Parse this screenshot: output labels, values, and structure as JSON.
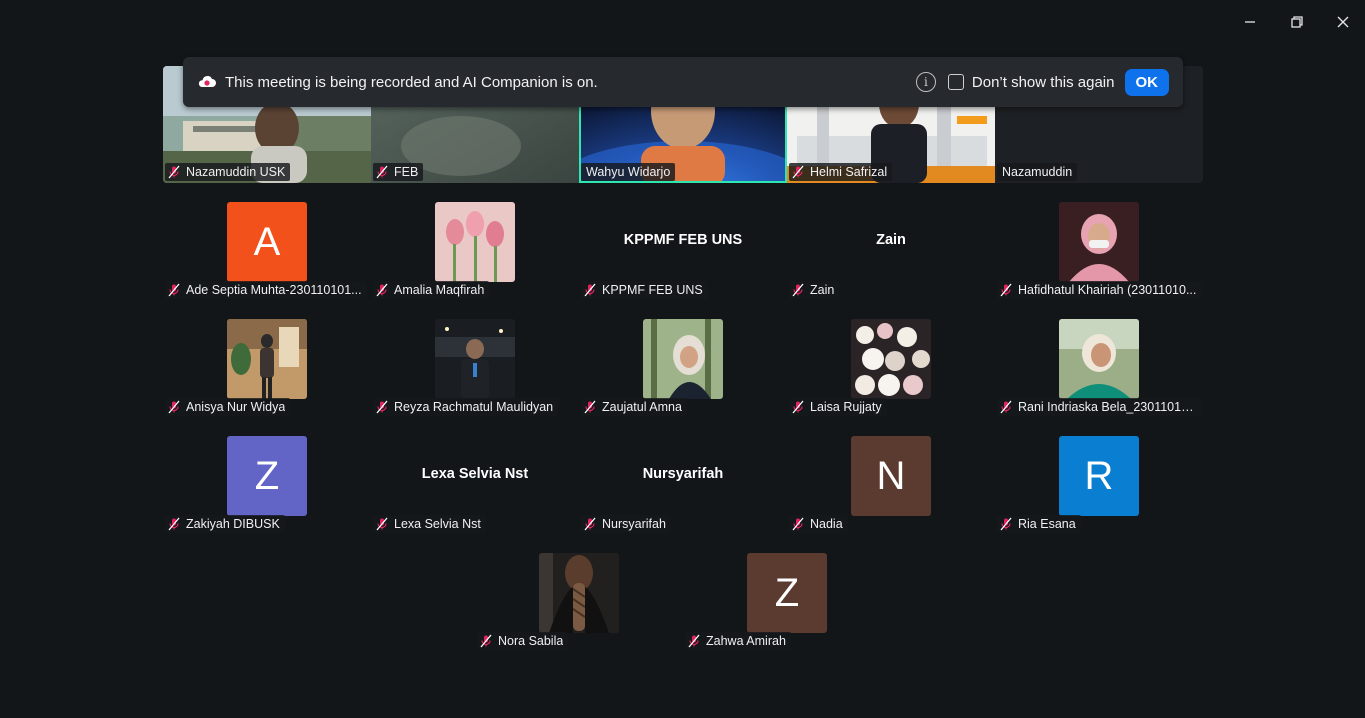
{
  "banner": {
    "text": "This meeting is being recorded and AI Companion is on.",
    "checkbox_label": "Don’t show this again",
    "ok_label": "OK"
  },
  "top_strip": [
    {
      "name": "Nazamuddin USK"
    },
    {
      "name": "FEB"
    },
    {
      "name": "Wahyu Widarjo"
    },
    {
      "name": "Helmi Safrizal"
    },
    {
      "name": "Nazamuddin"
    }
  ],
  "gallery": [
    {
      "name": "Ade Septia Muhta-230110101...",
      "initial": "A",
      "color": "#f2511b"
    },
    {
      "name": "Amalia Maqfirah",
      "photo": "tulips"
    },
    {
      "name": "KPPMF FEB UNS",
      "display": "KPPMF FEB UNS"
    },
    {
      "name": "Zain",
      "display": "Zain"
    },
    {
      "name": "Hafidhatul Khairiah (23011010...",
      "photo": "woman-hijab-pink"
    },
    {
      "name": "Anisya Nur Widya",
      "photo": "woman-cafe"
    },
    {
      "name": "Reyza Rachmatul Maulidyan",
      "photo": "man-night"
    },
    {
      "name": "Zaujatul Amna",
      "photo": "woman-forest"
    },
    {
      "name": "Laisa Rujjaty",
      "photo": "flowers"
    },
    {
      "name": "Rani Indriaska Bela_23011010...",
      "photo": "woman-green"
    },
    {
      "name": "Zakiyah DIBUSK",
      "initial": "Z",
      "color": "#6264c6"
    },
    {
      "name": "Lexa Selvia Nst",
      "display": "Lexa Selvia Nst"
    },
    {
      "name": "Nursyarifah",
      "display": "Nursyarifah"
    },
    {
      "name": "Nadia",
      "initial": "N",
      "color": "#5b3b30"
    },
    {
      "name": "Ria Esana",
      "initial": "R",
      "color": "#0a7fd1"
    },
    {
      "name": "Nora Sabila",
      "photo": "woman-braid"
    },
    {
      "name": "Zahwa Amirah",
      "initial": "Z",
      "color": "#5b3b30"
    }
  ],
  "icons": {
    "mic": "mic-muted-icon",
    "cloud": "cloud-record-icon",
    "info": "info-icon",
    "minimize": "minimize-icon",
    "restore": "restore-icon",
    "close": "close-icon"
  },
  "colors": {
    "background": "#131619",
    "active_speaker": "#2ee6b0",
    "ok_button": "#0e72ed",
    "muted_mic": "#e0245e"
  }
}
